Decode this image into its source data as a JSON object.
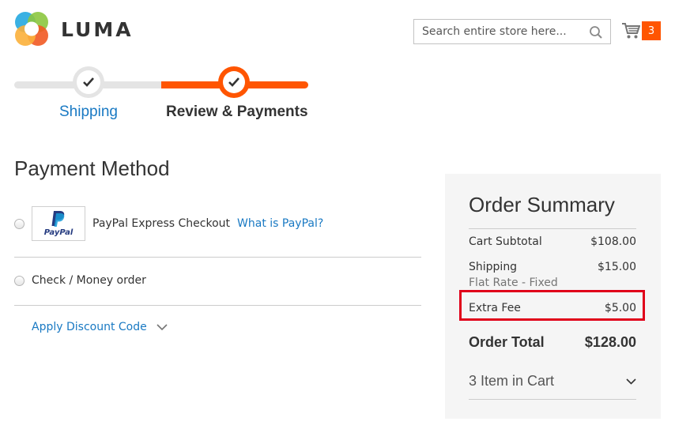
{
  "header": {
    "logo_text": "LUMA",
    "search": {
      "placeholder": "Search entire store here..."
    },
    "cart": {
      "count": "3"
    }
  },
  "progress": {
    "steps": [
      {
        "label": "Shipping",
        "state": "complete"
      },
      {
        "label": "Review & Payments",
        "state": "active"
      }
    ]
  },
  "payment": {
    "title": "Payment Method",
    "methods": [
      {
        "label": "PayPal Express Checkout",
        "link": "What is PayPal?",
        "logo_text": "PayPal"
      },
      {
        "label": "Check / Money order"
      }
    ],
    "discount_label": "Apply Discount Code"
  },
  "summary": {
    "title": "Order Summary",
    "rows": [
      {
        "label": "Cart Subtotal",
        "value": "$108.00"
      },
      {
        "label": "Shipping",
        "value": "$15.00",
        "sub": "Flat Rate - Fixed"
      },
      {
        "label": "Extra Fee",
        "value": "$5.00"
      }
    ],
    "total": {
      "label": "Order Total",
      "value": "$128.00"
    },
    "items_label": "3 Item in Cart"
  },
  "colors": {
    "accent": "#ff5501",
    "link": "#1979c3",
    "highlight": "#e0001a"
  }
}
